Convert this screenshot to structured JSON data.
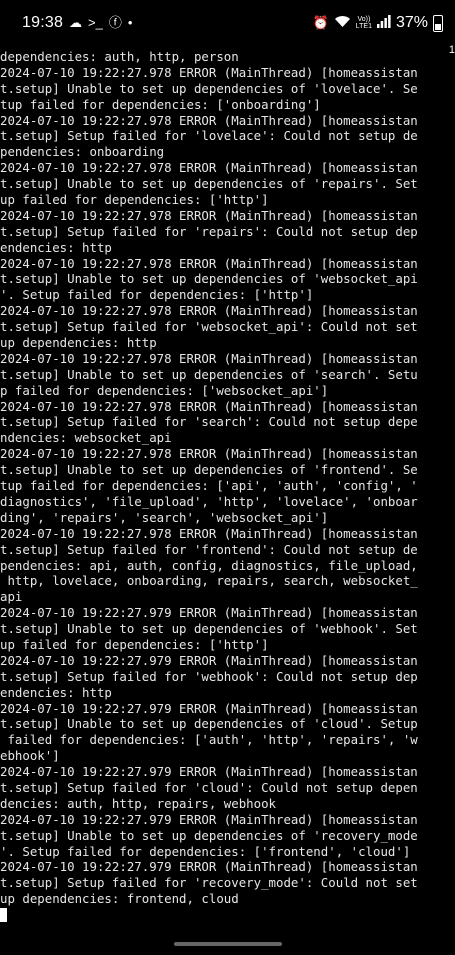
{
  "status_bar": {
    "time": "19:38",
    "network_label_top": "Vo))",
    "network_label_bottom": "LTE1",
    "battery_percent": "37%",
    "battery_level": 0.37
  },
  "side_marker": "1",
  "terminal": {
    "lines": [
      "dependencies: auth, http, person",
      "2024-07-10 19:22:27.978 ERROR (MainThread) [homeassistan",
      "t.setup] Unable to set up dependencies of 'lovelace'. Se",
      "tup failed for dependencies: ['onboarding']",
      "2024-07-10 19:22:27.978 ERROR (MainThread) [homeassistan",
      "t.setup] Setup failed for 'lovelace': Could not setup de",
      "pendencies: onboarding",
      "2024-07-10 19:22:27.978 ERROR (MainThread) [homeassistan",
      "t.setup] Unable to set up dependencies of 'repairs'. Set",
      "up failed for dependencies: ['http']",
      "2024-07-10 19:22:27.978 ERROR (MainThread) [homeassistan",
      "t.setup] Setup failed for 'repairs': Could not setup dep",
      "endencies: http",
      "2024-07-10 19:22:27.978 ERROR (MainThread) [homeassistan",
      "t.setup] Unable to set up dependencies of 'websocket_api",
      "'. Setup failed for dependencies: ['http']",
      "2024-07-10 19:22:27.978 ERROR (MainThread) [homeassistan",
      "t.setup] Setup failed for 'websocket_api': Could not set",
      "up dependencies: http",
      "2024-07-10 19:22:27.978 ERROR (MainThread) [homeassistan",
      "t.setup] Unable to set up dependencies of 'search'. Setu",
      "p failed for dependencies: ['websocket_api']",
      "2024-07-10 19:22:27.978 ERROR (MainThread) [homeassistan",
      "t.setup] Setup failed for 'search': Could not setup depe",
      "ndencies: websocket_api",
      "2024-07-10 19:22:27.978 ERROR (MainThread) [homeassistan",
      "t.setup] Unable to set up dependencies of 'frontend'. Se",
      "tup failed for dependencies: ['api', 'auth', 'config', '",
      "diagnostics', 'file_upload', 'http', 'lovelace', 'onboar",
      "ding', 'repairs', 'search', 'websocket_api']",
      "2024-07-10 19:22:27.978 ERROR (MainThread) [homeassistan",
      "t.setup] Setup failed for 'frontend': Could not setup de",
      "pendencies: api, auth, config, diagnostics, file_upload,",
      " http, lovelace, onboarding, repairs, search, websocket_",
      "api",
      "2024-07-10 19:22:27.979 ERROR (MainThread) [homeassistan",
      "t.setup] Unable to set up dependencies of 'webhook'. Set",
      "up failed for dependencies: ['http']",
      "2024-07-10 19:22:27.979 ERROR (MainThread) [homeassistan",
      "t.setup] Setup failed for 'webhook': Could not setup dep",
      "endencies: http",
      "2024-07-10 19:22:27.979 ERROR (MainThread) [homeassistan",
      "t.setup] Unable to set up dependencies of 'cloud'. Setup",
      " failed for dependencies: ['auth', 'http', 'repairs', 'w",
      "ebhook']",
      "2024-07-10 19:22:27.979 ERROR (MainThread) [homeassistan",
      "t.setup] Setup failed for 'cloud': Could not setup depen",
      "dencies: auth, http, repairs, webhook",
      "2024-07-10 19:22:27.979 ERROR (MainThread) [homeassistan",
      "t.setup] Unable to set up dependencies of 'recovery_mode",
      "'. Setup failed for dependencies: ['frontend', 'cloud']",
      "2024-07-10 19:22:27.979 ERROR (MainThread) [homeassistan",
      "t.setup] Setup failed for 'recovery_mode': Could not set",
      "up dependencies: frontend, cloud"
    ]
  }
}
